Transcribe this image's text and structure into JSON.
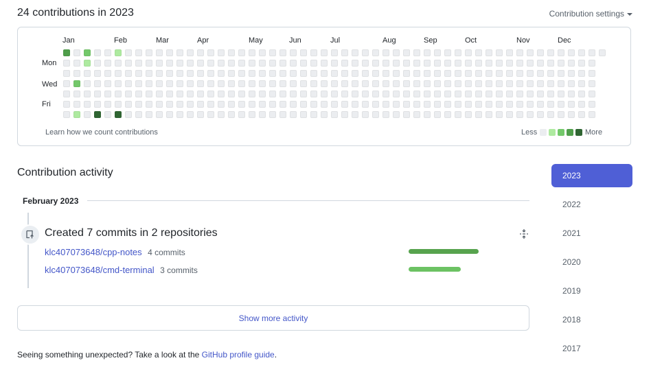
{
  "header": {
    "title": "24 contributions in 2023",
    "settings_label": "Contribution settings"
  },
  "calendar": {
    "months": [
      "Jan",
      "Feb",
      "Mar",
      "Apr",
      "May",
      "Jun",
      "Jul",
      "Aug",
      "Sep",
      "Oct",
      "Nov",
      "Dec"
    ],
    "day_labels": [
      "Mon",
      "Wed",
      "Fri"
    ],
    "learn_link": "Learn how we count contributions",
    "legend_less": "Less",
    "legend_more": "More",
    "colors": [
      "#ebedf0",
      "#aeeaa0",
      "#73c86a",
      "#4f9e4a",
      "#2f6532"
    ],
    "weeks": 53,
    "active_cells": [
      {
        "week": 0,
        "day": 0,
        "level": 3
      },
      {
        "week": 2,
        "day": 0,
        "level": 2
      },
      {
        "week": 5,
        "day": 0,
        "level": 1
      },
      {
        "week": 2,
        "day": 1,
        "level": 1
      },
      {
        "week": 1,
        "day": 3,
        "level": 2
      },
      {
        "week": 1,
        "day": 6,
        "level": 1
      },
      {
        "week": 3,
        "day": 6,
        "level": 4
      },
      {
        "week": 5,
        "day": 6,
        "level": 4
      }
    ]
  },
  "activity": {
    "title": "Contribution activity",
    "month": "February 2023",
    "summary": "Created 7 commits in 2 repositories",
    "repos": [
      {
        "name": "klc407073648/cpp-notes",
        "commits": "4 commits",
        "color": "#57a34e"
      },
      {
        "name": "klc407073648/cmd-terminal",
        "commits": "3 commits",
        "color": "#6cc263"
      }
    ],
    "show_more": "Show more activity"
  },
  "footer": {
    "text": "Seeing something unexpected? Take a look at the",
    "link": "GitHub profile guide",
    "end": "."
  },
  "years": [
    "2023",
    "2022",
    "2021",
    "2020",
    "2019",
    "2018",
    "2017"
  ],
  "accent": "#4f5fd6"
}
